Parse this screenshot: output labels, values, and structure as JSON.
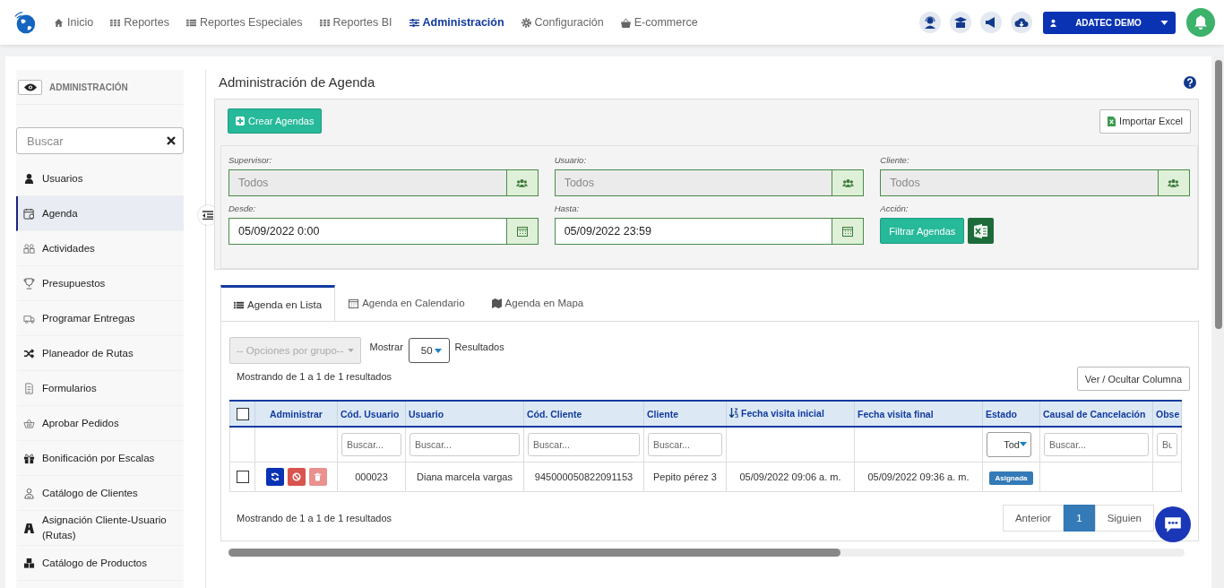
{
  "nav": {
    "items": [
      {
        "label": "Inicio",
        "selected": false
      },
      {
        "label": "Reportes",
        "selected": false
      },
      {
        "label": "Reportes Especiales",
        "selected": false
      },
      {
        "label": "Reportes BI",
        "selected": false
      },
      {
        "label": "Administración",
        "selected": true
      },
      {
        "label": "Configuración",
        "selected": false
      },
      {
        "label": "E-commerce",
        "selected": false
      }
    ],
    "user": "ADATEC DEMO"
  },
  "sidebar": {
    "title": "ADMINISTRACIÓN",
    "search": {
      "placeholder": "Buscar"
    },
    "items": [
      {
        "label": "Usuarios",
        "selected": false
      },
      {
        "label": "Agenda",
        "selected": true
      },
      {
        "label": "Actividades",
        "selected": false
      },
      {
        "label": "Presupuestos",
        "selected": false
      },
      {
        "label": "Programar Entregas",
        "selected": false
      },
      {
        "label": "Planeador de Rutas",
        "selected": false
      },
      {
        "label": "Formularios",
        "selected": false
      },
      {
        "label": "Aprobar Pedidos",
        "selected": false
      },
      {
        "label": "Bonificación por Escalas",
        "selected": false
      },
      {
        "label": "Catálogo de Clientes",
        "selected": false
      },
      {
        "label": "Asignación Cliente-Usuario (Rutas)",
        "selected": false
      },
      {
        "label": "Catálogo de Productos",
        "selected": false
      }
    ]
  },
  "page": {
    "title": "Administración de Agenda",
    "create_button": "Crear Agendas",
    "import_button": "Importar Excel",
    "filters": [
      {
        "label": "Supervisor:",
        "value": "Todos",
        "kind": "select"
      },
      {
        "label": "Usuario:",
        "value": "Todos",
        "kind": "select"
      },
      {
        "label": "Cliente:",
        "value": "Todos",
        "kind": "select"
      },
      {
        "label": "Desde:",
        "value": "05/09/2022 0:00",
        "kind": "date"
      },
      {
        "label": "Hasta:",
        "value": "05/09/2022 23:59",
        "kind": "date"
      }
    ],
    "action_label": "Acción:",
    "filter_button": "Filtrar Agendas"
  },
  "tabs": [
    {
      "label": "Agenda en Lista",
      "selected": true
    },
    {
      "label": "Agenda en Calendario",
      "selected": false
    },
    {
      "label": "Agenda en Mapa",
      "selected": false
    }
  ],
  "list": {
    "group_select": "-- Opciones por grupo--",
    "show_label": "Mostrar",
    "page_size": "50",
    "results_label": "Resultados",
    "info_top": "Mostrando de 1 a 1 de 1 resultados",
    "columns_button": "Ver / Ocultar Columna",
    "table": {
      "select_all_checked": false,
      "columns": [
        {
          "label": "Administrar",
          "kind": "actions",
          "sorted": false
        },
        {
          "label": "Cód. Usuario",
          "kind": "text",
          "sorted": false,
          "filter_placeholder": "Buscar..."
        },
        {
          "label": "Usuario",
          "kind": "text",
          "sorted": false,
          "filter_placeholder": "Buscar..."
        },
        {
          "label": "Cód. Cliente",
          "kind": "text",
          "sorted": false,
          "filter_placeholder": "Buscar..."
        },
        {
          "label": "Cliente",
          "kind": "text",
          "sorted": false,
          "filter_placeholder": "Buscar..."
        },
        {
          "label": "Fecha visita inicial",
          "kind": "text",
          "sorted": true
        },
        {
          "label": "Fecha visita final",
          "kind": "text",
          "sorted": false
        },
        {
          "label": "Estado",
          "kind": "status",
          "sorted": false,
          "filter_value": "Tod"
        },
        {
          "label": "Causal de Cancelación",
          "kind": "text",
          "sorted": false,
          "filter_placeholder": "Buscar..."
        },
        {
          "label": "Obse",
          "kind": "text",
          "sorted": false,
          "filter_placeholder": "Bu"
        }
      ],
      "rows": [
        {
          "checked": false,
          "cells": [
            "",
            "000023",
            "Diana marcela vargas",
            "945000050822091153",
            "Pepito pérez 3",
            "05/09/2022 09:06 a. m.",
            "05/09/2022 09:36 a. m.",
            "Asignada"
          ]
        }
      ]
    },
    "info_bottom": "Mostrando de 1 a 1 de 1 resultados",
    "pagination": [
      {
        "label": "Anterior",
        "selected": false
      },
      {
        "label": "1",
        "selected": true
      },
      {
        "label": "Siguien",
        "selected": false
      }
    ]
  }
}
